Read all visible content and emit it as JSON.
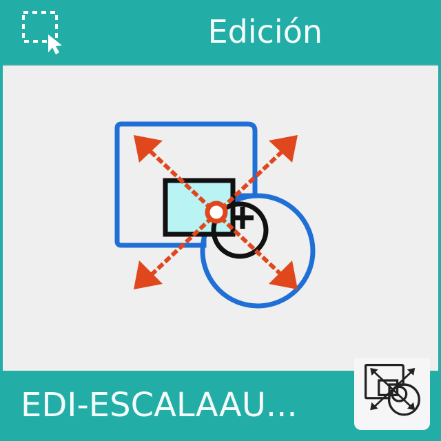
{
  "tile": {
    "category_title": "Edición",
    "command_label": "EDI-ESCALAAU...",
    "header_icon": "select-window-icon",
    "main_icon": "scale-auto-icon",
    "thumbnail_icon": "scale-auto-thumbnail-icon"
  },
  "colors": {
    "accent": "#22aea6",
    "canvas": "#efefef",
    "icon_blue": "#1f6fd6",
    "icon_orange": "#e0471c",
    "icon_fill": "#b9f3f3"
  }
}
